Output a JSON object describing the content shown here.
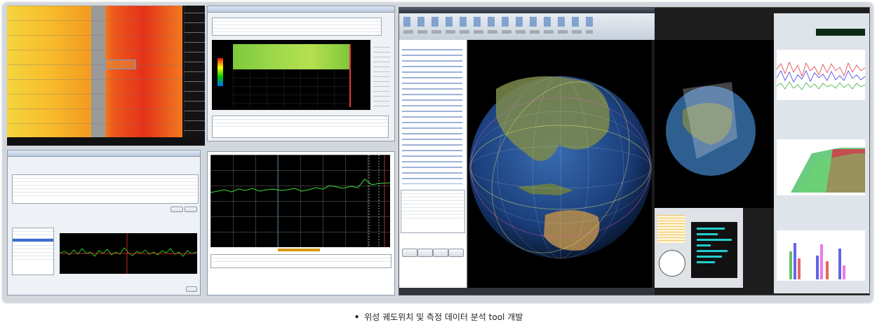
{
  "caption": {
    "bullet": "•",
    "text": "위성 궤도위치 및 측정 데이터 분석 tool 개발"
  },
  "colors": {
    "frame": "#d2d7dd",
    "heatmap_hot": "#e8321a",
    "heatmap_warm": "#f7b928",
    "spectrum_trace": "#39e03a",
    "globe_ocean": "#1a3c7a",
    "highlight_red": "#e3233f"
  },
  "icons": [
    "orbit-icon",
    "globe-icon",
    "satellite-icon",
    "chart-icon",
    "settings-icon"
  ]
}
